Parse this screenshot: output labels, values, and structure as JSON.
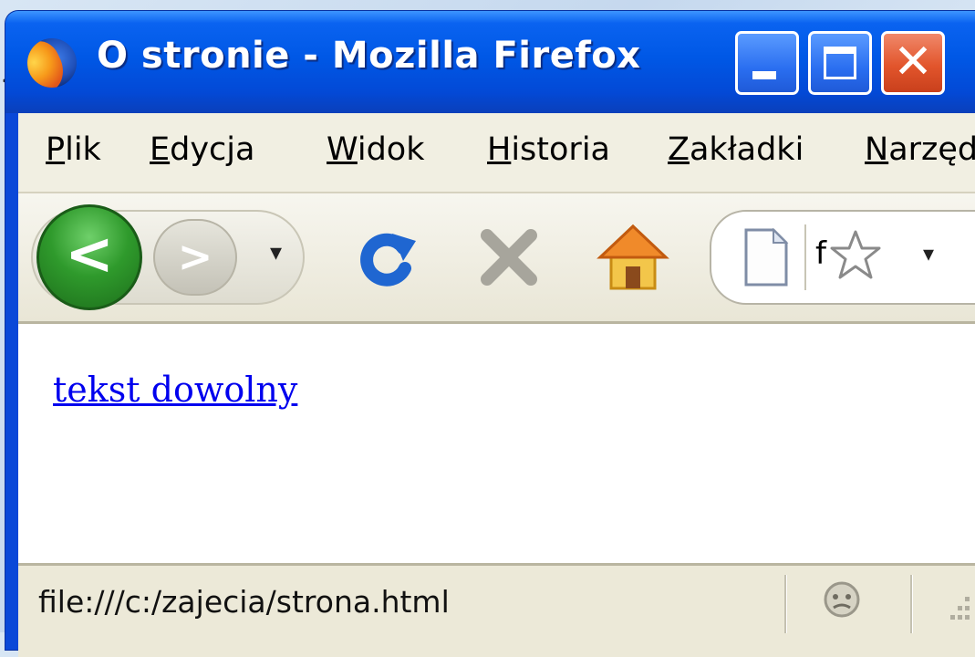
{
  "stray_glyph": "<",
  "window": {
    "title": "O stronie - Mozilla Firefox",
    "icon": "firefox-icon",
    "controls": {
      "minimize": "minimize-icon",
      "maximize": "maximize-icon",
      "close": "close-icon"
    }
  },
  "menubar": {
    "items": [
      {
        "accel": "P",
        "rest": "lik"
      },
      {
        "accel": "E",
        "rest": "dycja"
      },
      {
        "accel": "W",
        "rest": "idok"
      },
      {
        "accel": "H",
        "rest": "istoria"
      },
      {
        "accel": "Z",
        "rest": "akładki"
      },
      {
        "accel": "N",
        "rest": "arzęd"
      }
    ]
  },
  "toolbar": {
    "back_glyph": "<",
    "forward_glyph": ">",
    "history_dropdown_glyph": "▾",
    "url_text": "f",
    "url_dropdown_glyph": "▾"
  },
  "content": {
    "link_text": "tekst dowolny"
  },
  "statusbar": {
    "text": "file:///c:/zajecia/strona.html"
  },
  "colors": {
    "titlebar": "#0058e6",
    "link": "#0000ee",
    "back_button": "#2f9a2c",
    "reload": "#1f66d1",
    "close_button": "#e2552c"
  }
}
